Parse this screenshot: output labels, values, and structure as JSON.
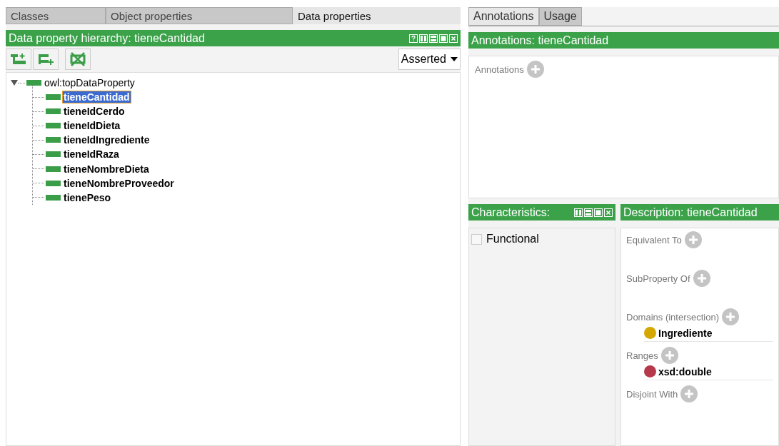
{
  "left_tabs": [
    {
      "label": "Classes",
      "selected": false
    },
    {
      "label": "Object properties",
      "selected": false
    },
    {
      "label": "Data properties",
      "selected": true
    }
  ],
  "hierarchy": {
    "title": "Data property hierarchy: tieneCantidad",
    "view_select": "Asserted",
    "tree": {
      "label": "owl:topDataProperty",
      "expanded": true,
      "selected": false,
      "children": [
        {
          "label": "tieneCantidad",
          "selected": true
        },
        {
          "label": "tieneIdCerdo",
          "selected": false
        },
        {
          "label": "tieneIdDieta",
          "selected": false
        },
        {
          "label": "tieneIdIngrediente",
          "selected": false
        },
        {
          "label": "tieneIdRaza",
          "selected": false
        },
        {
          "label": "tieneNombreDieta",
          "selected": false
        },
        {
          "label": "tieneNombreProveedor",
          "selected": false
        },
        {
          "label": "tienePeso",
          "selected": false
        }
      ]
    }
  },
  "right_tabs": [
    {
      "label": "Annotations",
      "selected": true
    },
    {
      "label": "Usage",
      "selected": false
    }
  ],
  "annotations": {
    "title": "Annotations: tieneCantidad",
    "section": "Annotations"
  },
  "characteristics": {
    "title": "Characteristics:",
    "items": [
      {
        "label": "Functional",
        "checked": false
      }
    ]
  },
  "description": {
    "title": "Description: tieneCantidad",
    "sections": [
      {
        "label": "Equivalent To"
      },
      {
        "label": "SubProperty Of"
      },
      {
        "label": "Domains (intersection)",
        "items": [
          {
            "label": "Ingrediente",
            "color": "#d4a800"
          }
        ]
      },
      {
        "label": "Ranges",
        "items": [
          {
            "label": "xsd:double",
            "color": "#b5394a"
          }
        ]
      },
      {
        "label": "Disjoint With"
      }
    ]
  }
}
